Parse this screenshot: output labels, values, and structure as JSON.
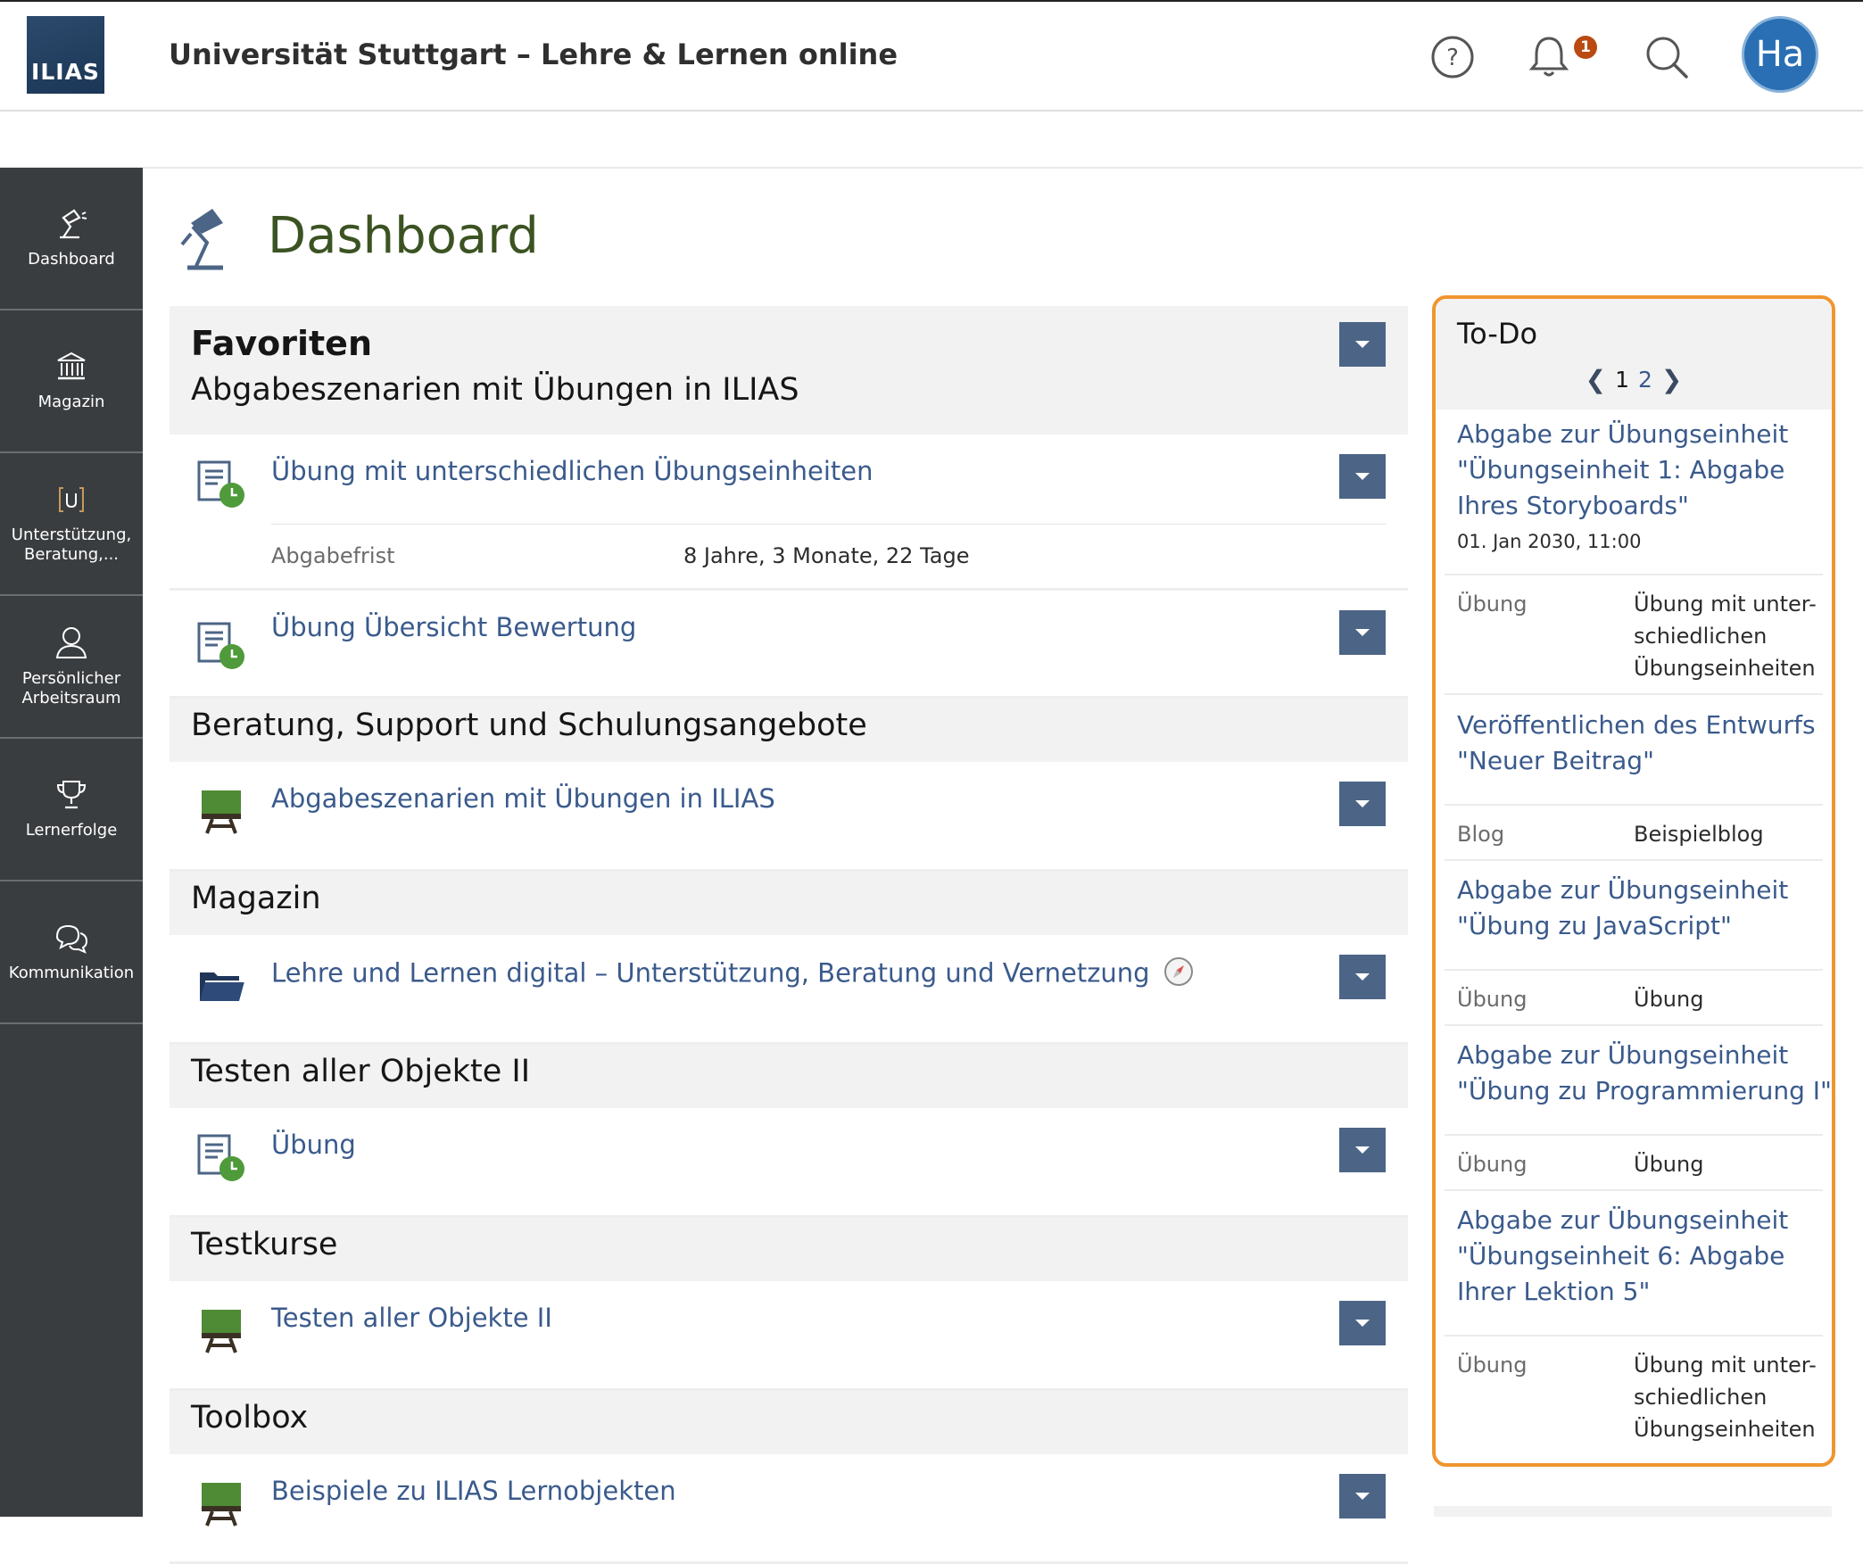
{
  "header": {
    "logo_text": "ILIAS",
    "site_title": "Universität Stuttgart – Lehre & Lernen online",
    "notification_count": "1",
    "avatar_initials": "Ha",
    "icons": [
      "help-icon",
      "bell-icon",
      "search-icon"
    ]
  },
  "sidebar": {
    "items": [
      {
        "label": "Dashboard",
        "icon": "desk-lamp-icon"
      },
      {
        "label": "Magazin",
        "icon": "library-icon"
      },
      {
        "label": "Unterstützung, Beratung,...",
        "icon": "bracket-u-icon"
      },
      {
        "label": "Persönlicher Arbeitsraum",
        "icon": "person-icon"
      },
      {
        "label": "Lernerfolge",
        "icon": "trophy-icon"
      },
      {
        "label": "Kommunikation",
        "icon": "chat-bubbles-icon"
      }
    ]
  },
  "main": {
    "page_title": "Dashboard",
    "favorites_title": "Favoriten",
    "groups": [
      {
        "heading": "Abgabeszenarien mit Übungen in ILIAS",
        "items": [
          {
            "title": "Übung mit unterschiedlichen Übungseinheiten",
            "icon": "exercise-icon",
            "prop_label": "Abgabefrist",
            "prop_value": "8 Jahre, 3 Monate, 22 Tage"
          },
          {
            "title": "Übung Übersicht Bewertung",
            "icon": "exercise-icon"
          }
        ]
      },
      {
        "heading": "Beratung, Support und Schulungsangebote",
        "items": [
          {
            "title": "Abgabeszenarien mit Übungen in ILIAS",
            "icon": "course-board-icon"
          }
        ]
      },
      {
        "heading": "Magazin",
        "items": [
          {
            "title": "Lehre und Lernen digital – Unterstützung, Beratung und Vernetzung",
            "icon": "folder-icon"
          }
        ]
      },
      {
        "heading": "Testen aller Objekte II",
        "items": [
          {
            "title": "Übung",
            "icon": "exercise-icon"
          }
        ]
      },
      {
        "heading": "Testkurse",
        "items": [
          {
            "title": "Testen aller Objekte II",
            "icon": "course-board-icon"
          }
        ]
      },
      {
        "heading": "Toolbox",
        "items": [
          {
            "title": "Beispiele zu ILIAS Lernobjekten",
            "icon": "course-board-icon"
          }
        ]
      }
    ]
  },
  "todo": {
    "title": "To-Do",
    "pages": [
      "1",
      "2"
    ],
    "current_page": "1",
    "entries": [
      {
        "title": "Abgabe zur Übungseinheit \"Übungseinheit 1: Abgabe Ihres Storyboards\"",
        "date": "01. Jan 2030, 11:00",
        "label": "Übung",
        "value": "Übung mit unter-schiedlichen Übungseinheiten"
      },
      {
        "title": "Veröffentlichen des Entwurfs \"Neuer Beitrag\"",
        "label": "Blog",
        "value": "Beispielblog"
      },
      {
        "title": "Abgabe zur Übungseinheit \"Übung zu JavaScript\"",
        "label": "Übung",
        "value": "Übung"
      },
      {
        "title": "Abgabe zur Übungseinheit \"Übung zu Programmierung I\"",
        "label": "Übung",
        "value": "Übung"
      },
      {
        "title": "Abgabe zur Übungseinheit \"Übungseinheit 6: Abgabe Ihrer Lektion 5\"",
        "label": "Übung",
        "value": "Übung mit unter-schiedlichen Übungseinheiten"
      }
    ]
  },
  "colors": {
    "link": "#3a5a8c",
    "page_title": "#3b5322",
    "sidebar": "#3a3d3f",
    "dropdown": "#4c6586",
    "todo_border": "#f0952f",
    "badge": "#b94a12",
    "avatar": "#2a6fb3"
  }
}
